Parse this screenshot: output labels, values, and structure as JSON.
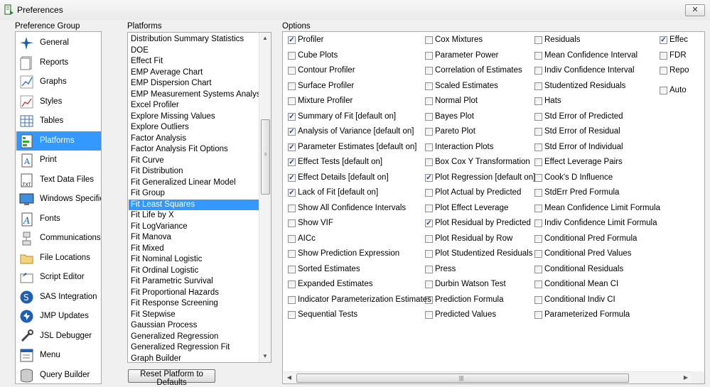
{
  "window": {
    "title": "Preferences",
    "close_label": "✕"
  },
  "preference_group": {
    "label": "Preference Group",
    "items": [
      {
        "label": "General",
        "icon": "general-icon"
      },
      {
        "label": "Reports",
        "icon": "reports-icon"
      },
      {
        "label": "Graphs",
        "icon": "graphs-icon"
      },
      {
        "label": "Styles",
        "icon": "styles-icon"
      },
      {
        "label": "Tables",
        "icon": "tables-icon"
      },
      {
        "label": "Platforms",
        "icon": "platforms-icon",
        "selected": true
      },
      {
        "label": "Print",
        "icon": "print-icon"
      },
      {
        "label": "Text Data Files",
        "icon": "text-data-files-icon"
      },
      {
        "label": "Windows Specific",
        "icon": "windows-specific-icon"
      },
      {
        "label": "Fonts",
        "icon": "fonts-icon"
      },
      {
        "label": "Communications",
        "icon": "communications-icon"
      },
      {
        "label": "File Locations",
        "icon": "file-locations-icon"
      },
      {
        "label": "Script Editor",
        "icon": "script-editor-icon"
      },
      {
        "label": "SAS Integration",
        "icon": "sas-integration-icon"
      },
      {
        "label": "JMP Updates",
        "icon": "jmp-updates-icon"
      },
      {
        "label": "JSL Debugger",
        "icon": "jsl-debugger-icon"
      },
      {
        "label": "Menu",
        "icon": "menu-icon"
      },
      {
        "label": "Query Builder",
        "icon": "query-builder-icon"
      }
    ]
  },
  "platforms": {
    "label": "Platforms",
    "selected": "Fit Least Squares",
    "items": [
      "Distribution Summary Statistics",
      "DOE",
      "Effect Fit",
      "EMP Average Chart",
      "EMP Dispersion Chart",
      "EMP Measurement Systems Analysis",
      "Excel Profiler",
      "Explore Missing Values",
      "Explore Outliers",
      "Factor Analysis",
      "Factor Analysis Fit Options",
      "Fit Curve",
      "Fit Distribution",
      "Fit Generalized Linear Model",
      "Fit Group",
      "Fit Least Squares",
      "Fit Life by X",
      "Fit LogVariance",
      "Fit Manova",
      "Fit Mixed",
      "Fit Nominal Logistic",
      "Fit Ordinal Logistic",
      "Fit Parametric Survival",
      "Fit Proportional Hazards",
      "Fit Response Screening",
      "Fit Stepwise",
      "Gaussian Process",
      "Generalized Regression",
      "Generalized Regression Fit",
      "Graph Builder"
    ],
    "reset_label": "Reset Platform to Defaults"
  },
  "options": {
    "label": "Options",
    "columns": [
      [
        {
          "label": "Profiler",
          "checked": true
        },
        {
          "label": "Cube Plots",
          "checked": false
        },
        {
          "label": "Contour Profiler",
          "checked": false
        },
        {
          "label": "Surface Profiler",
          "checked": false
        },
        {
          "label": "Mixture Profiler",
          "checked": false
        },
        {
          "label": "Summary of Fit [default on]",
          "checked": true
        },
        {
          "label": "Analysis of Variance [default on]",
          "checked": true
        },
        {
          "label": "Parameter Estimates [default on]",
          "checked": true
        },
        {
          "label": "Effect Tests [default on]",
          "checked": true
        },
        {
          "label": "Effect Details [default on]",
          "checked": true
        },
        {
          "label": "Lack of Fit [default on]",
          "checked": true
        },
        {
          "label": "Show All Confidence Intervals",
          "checked": false
        },
        {
          "label": "Show VIF",
          "checked": false
        },
        {
          "label": "AICc",
          "checked": false
        },
        {
          "label": "Show Prediction Expression",
          "checked": false
        },
        {
          "label": "Sorted Estimates",
          "checked": false
        },
        {
          "label": "Expanded  Estimates",
          "checked": false
        },
        {
          "label": "Indicator Parameterization Estimates",
          "checked": false
        },
        {
          "label": "Sequential Tests",
          "checked": false
        }
      ],
      [
        {
          "label": "Cox Mixtures",
          "checked": false
        },
        {
          "label": "Parameter Power",
          "checked": false
        },
        {
          "label": "Correlation of Estimates",
          "checked": false
        },
        {
          "label": "Scaled Estimates",
          "checked": false
        },
        {
          "label": "Normal Plot",
          "checked": false
        },
        {
          "label": "Bayes Plot",
          "checked": false
        },
        {
          "label": "Pareto Plot",
          "checked": false
        },
        {
          "label": "Interaction Plots",
          "checked": false
        },
        {
          "label": "Box Cox Y Transformation",
          "checked": false
        },
        {
          "label": "Plot Regression [default on]",
          "checked": true
        },
        {
          "label": "Plot Actual by Predicted",
          "checked": false
        },
        {
          "label": "Plot Effect Leverage",
          "checked": false
        },
        {
          "label": "Plot Residual by Predicted",
          "checked": true
        },
        {
          "label": "Plot Residual by Row",
          "checked": false
        },
        {
          "label": "Plot Studentized Residuals",
          "checked": false
        },
        {
          "label": "Press",
          "checked": false
        },
        {
          "label": "Durbin Watson Test",
          "checked": false
        },
        {
          "label": "Prediction Formula",
          "checked": false
        },
        {
          "label": "Predicted Values",
          "checked": false
        }
      ],
      [
        {
          "label": "Residuals",
          "checked": false
        },
        {
          "label": "Mean Confidence Interval",
          "checked": false
        },
        {
          "label": "Indiv Confidence Interval",
          "checked": false
        },
        {
          "label": "Studentized Residuals",
          "checked": false
        },
        {
          "label": "Hats",
          "checked": false
        },
        {
          "label": "Std Error of Predicted",
          "checked": false
        },
        {
          "label": "Std Error of Residual",
          "checked": false
        },
        {
          "label": "Std Error of Individual",
          "checked": false
        },
        {
          "label": "Effect Leverage Pairs",
          "checked": false
        },
        {
          "label": "Cook's D Influence",
          "checked": false
        },
        {
          "label": "StdErr Pred Formula",
          "checked": false
        },
        {
          "label": "Mean Confidence Limit Formula",
          "checked": false
        },
        {
          "label": "Indiv Confidence Limit Formula",
          "checked": false
        },
        {
          "label": "Conditional Pred Formula",
          "checked": false
        },
        {
          "label": "Conditional Pred Values",
          "checked": false
        },
        {
          "label": "Conditional Residuals",
          "checked": false
        },
        {
          "label": "Conditional Mean CI",
          "checked": false
        },
        {
          "label": "Conditional Indiv CI",
          "checked": false
        },
        {
          "label": "Parameterized Formula",
          "checked": false
        }
      ],
      [
        {
          "label": "Effec",
          "checked": true
        },
        {
          "label": "FDR",
          "checked": false
        },
        {
          "label": "Repo",
          "checked": false
        },
        {
          "label": "Auto",
          "checked": false,
          "gap_before": true
        }
      ]
    ]
  },
  "colors": {
    "selection": "#3399ff",
    "check": "#23427d"
  }
}
